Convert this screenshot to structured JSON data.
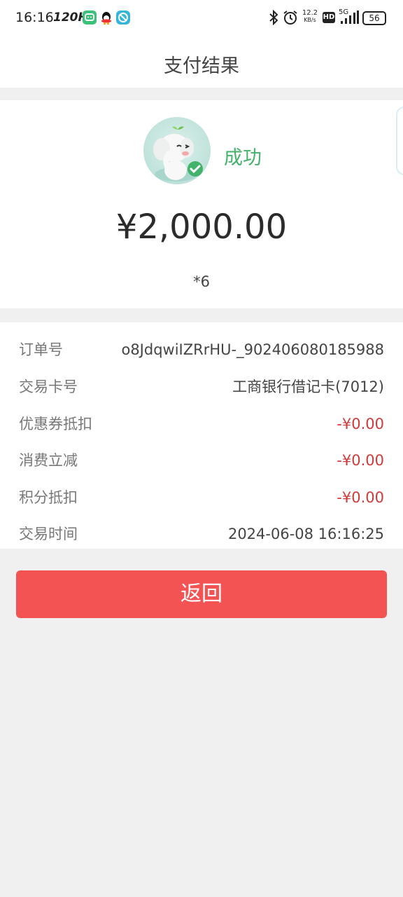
{
  "status_bar": {
    "time": "16:16",
    "refresh_rate": "120Hz",
    "net_speed_value": "12.2",
    "net_speed_unit": "KB/s",
    "hd_badge": "HD",
    "network": "5G",
    "battery": "56",
    "icons": [
      "message-app-icon",
      "qq-icon",
      "browser-app-icon",
      "bluetooth-icon",
      "alarm-icon",
      "signal-icon",
      "battery-icon"
    ]
  },
  "header": {
    "title": "支付结果"
  },
  "result": {
    "status": "成功",
    "amount": "¥2,000.00",
    "payee": "*6",
    "mascot_icon": "elephant-mascot-success-icon",
    "success_color": "#43b26a"
  },
  "details": {
    "rows": [
      {
        "label": "订单号",
        "value": "o8JdqwiIZRrHU-_902406080185988"
      },
      {
        "label": "交易卡号",
        "value": "工商银行借记卡(7012)"
      },
      {
        "label": "优惠券抵扣",
        "value": "-¥0.00"
      },
      {
        "label": "消费立减",
        "value": "-¥0.00"
      },
      {
        "label": "积分抵扣",
        "value": "-¥0.00"
      },
      {
        "label": "交易时间",
        "value": "2024-06-08 16:16:25"
      }
    ],
    "discount_color": "#cf3a3a"
  },
  "actions": {
    "back_label": "返回",
    "back_color": "#f45353"
  }
}
